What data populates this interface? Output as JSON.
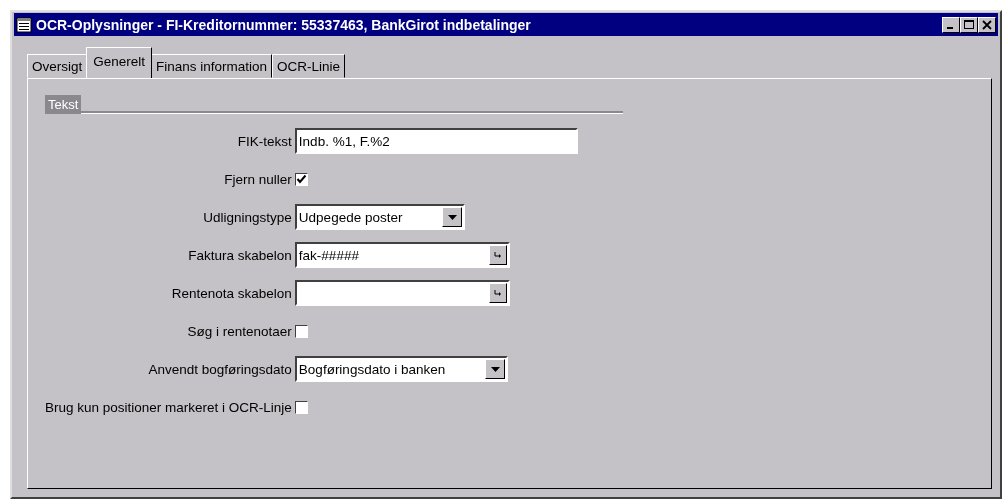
{
  "window": {
    "title": "OCR-Oplysninger - FI-Kreditornummer: 55337463, BankGirot indbetalinger"
  },
  "tabs": [
    {
      "label": "Oversigt",
      "selected": false
    },
    {
      "label": "Generelt",
      "selected": true
    },
    {
      "label": "Finans information",
      "selected": false
    },
    {
      "label": "OCR-Linie",
      "selected": false
    }
  ],
  "group": {
    "title": "Tekst"
  },
  "fields": [
    {
      "kind": "text",
      "label": "FIK-tekst",
      "value": "Indb. %1, F.%2"
    },
    {
      "kind": "checkbox",
      "label": "Fjern nuller",
      "checked": true
    },
    {
      "kind": "dropdown",
      "label": "Udligningstype",
      "value": "Udpegede poster"
    },
    {
      "kind": "lookup",
      "label": "Faktura skabelon",
      "value": "fak-#####"
    },
    {
      "kind": "lookup",
      "label": "Rentenota skabelon"
    },
    {
      "kind": "checkbox",
      "label": "Søg i rentenotaer",
      "checked": false
    },
    {
      "kind": "dropdown",
      "label": "Anvendt bogføringsdato",
      "value": "Bogføringsdato i banken"
    },
    {
      "kind": "checkbox",
      "label": "Brug kun positioner markeret i OCR-Linje",
      "checked": false
    }
  ]
}
